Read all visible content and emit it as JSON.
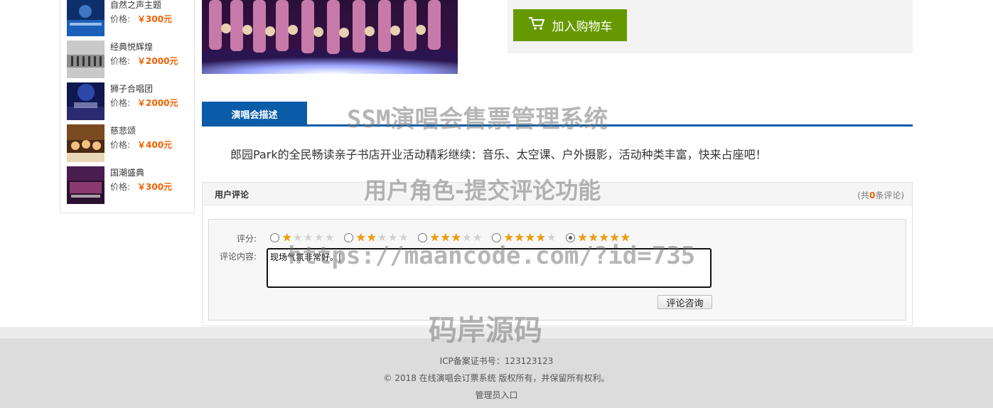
{
  "sidebar": {
    "items": [
      {
        "name": "自然之声主题",
        "price_label": "价格:",
        "price": "￥300元"
      },
      {
        "name": "经典悦辉煌",
        "price_label": "价格:",
        "price": "￥2000元"
      },
      {
        "name": "狮子合唱团",
        "price_label": "价格:",
        "price": "￥2000元"
      },
      {
        "name": "慈悲颂",
        "price_label": "价格:",
        "price": "￥400元"
      },
      {
        "name": "国潮盛典",
        "price_label": "价格:",
        "price": "￥300元"
      }
    ]
  },
  "buy": {
    "cart_label": "加入购物车"
  },
  "description": {
    "tab_label": "演唱会描述",
    "text": "郎园Park的全民畅读亲子书店开业活动精彩继续：音乐、太空课、户外摄影，活动种类丰富，快来占座吧！"
  },
  "watermarks": {
    "title": "SSM演唱会售票管理系统",
    "subtitle": "用户角色-提交评论功能",
    "url": "https://maancode.com/?id=735",
    "brand": "码岸源码"
  },
  "comments": {
    "title": "用户评论",
    "count_prefix": "(共",
    "count": "0",
    "count_suffix": "条评论)",
    "rating_label": "评分:",
    "content_label": "评论内容:",
    "content_value": "现场气氛非常好。|",
    "submit_label": "评论咨询",
    "rating_options": [
      1,
      2,
      3,
      4,
      5
    ],
    "selected_rating": 5
  },
  "footer": {
    "icp": "ICP备案证书号：123123123",
    "copyright": "© 2018 在线演唱会订票系统 版权所有，并保留所有权利。",
    "admin_link": "管理员入口"
  },
  "colors": {
    "accent_green": "#669900",
    "accent_blue": "#0a5ca8",
    "price_orange": "#f06000"
  }
}
